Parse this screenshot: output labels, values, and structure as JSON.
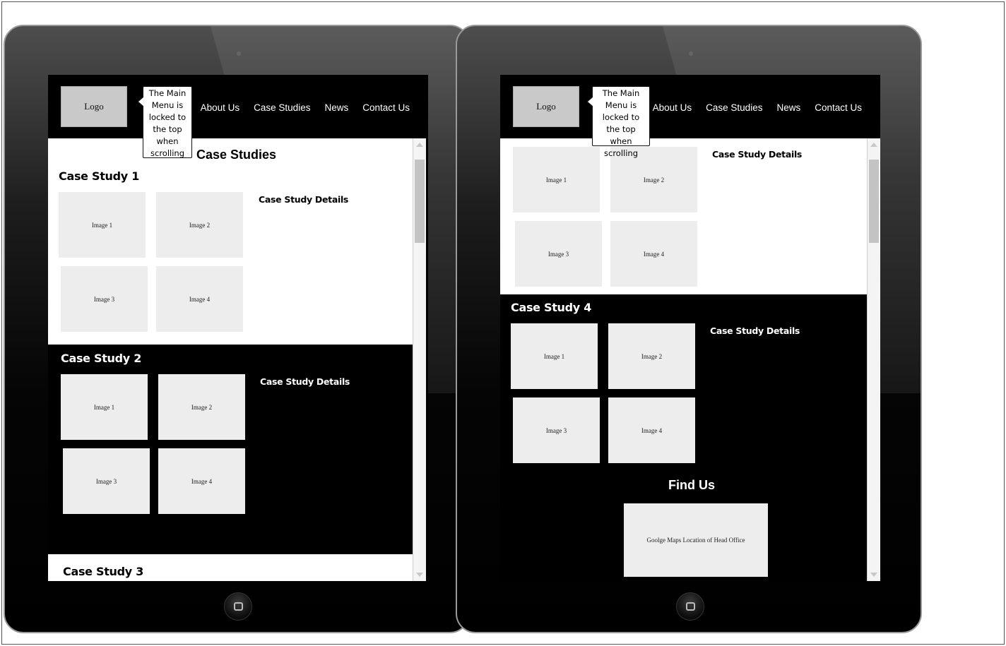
{
  "left_tablet": {
    "logo": "Logo",
    "menu": [
      "About Us",
      "Case Studies",
      "News",
      "Contact Us"
    ],
    "callout": "The Main Menu is locked to the top when scrolling",
    "page_title": "Case Studies",
    "cs1": {
      "title": "Case Study 1",
      "details": "Case Study Details",
      "images": [
        "Image 1",
        "Image 2",
        "Image 3",
        "Image 4"
      ]
    },
    "cs2": {
      "title": "Case Study 2",
      "details": "Case Study Details",
      "images": [
        "Image 1",
        "Image 2",
        "Image 3",
        "Image 4"
      ]
    },
    "cs3": {
      "title": "Case Study 3"
    }
  },
  "right_tablet": {
    "logo": "Logo",
    "menu": [
      "About Us",
      "Case Studies",
      "News",
      "Contact Us"
    ],
    "callout": "The Main Menu is locked to the top when scrolling",
    "cs3": {
      "details": "Case Study Details",
      "images": [
        "Image 1",
        "Image 2",
        "Image 3",
        "Image 4"
      ]
    },
    "cs4": {
      "title": "Case Study 4",
      "details": "Case Study Details",
      "images": [
        "Image 1",
        "Image 2",
        "Image 3",
        "Image 4"
      ]
    },
    "find_us": {
      "title": "Find Us",
      "map": "Goolge Maps Location of Head Office"
    }
  },
  "colors": {
    "page_bg": "#ffffff",
    "tablet": "#000000",
    "placeholder": "#ededed",
    "logo": "#c9c9c9"
  }
}
